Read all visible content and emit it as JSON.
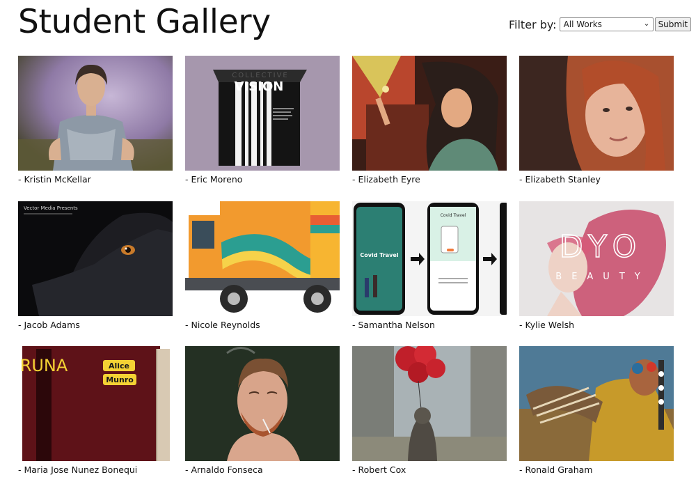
{
  "header": {
    "title": "Student Gallery"
  },
  "filter": {
    "label": "Filter by:",
    "selected": "All Works",
    "submit_label": "Submit"
  },
  "gallery": {
    "items": [
      {
        "caption": "- Kristin McKellar",
        "art": "painted woman in grey dress, purple background"
      },
      {
        "caption": "- Eric Moreno",
        "art": "black VISION box packaging, COLLECTIVE text"
      },
      {
        "caption": "- Elizabeth Eyre",
        "art": "illustrated man holding cigarette, warm tones"
      },
      {
        "caption": "- Elizabeth Stanley",
        "art": "portrait of red-haired woman"
      },
      {
        "caption": "- Jacob Adams",
        "art": "black dog close-up, Vector Media Presents"
      },
      {
        "caption": "- Nicole Reynolds",
        "art": "orange truck with striped livery"
      },
      {
        "caption": "- Samantha Nelson",
        "art": "Covid Travel app screens"
      },
      {
        "caption": "- Kylie Welsh",
        "art": "DYO BEAUTY, pink-haired woman"
      },
      {
        "caption": "- Maria Jose Nunez Bonequi",
        "art": "RUNA book cover, Alice Munro"
      },
      {
        "caption": "- Arnaldo Fonseca",
        "art": "bearded man smoking portrait"
      },
      {
        "caption": "- Robert Cox",
        "art": "red balloons in misty forest"
      },
      {
        "caption": "- Ronald Graham",
        "art": "native dancer with feathered regalia"
      }
    ]
  },
  "artwork_text": {
    "eric_top": "COLLECTIVE",
    "eric_main": "VISION",
    "jacob_line": "Vector Media Presents",
    "samantha_title": "Covid Travel",
    "samantha_screen2": "Covid Travel",
    "kylie_main": "DYO",
    "kylie_sub": "BEAUTY",
    "maria_title": "RUNA",
    "maria_author_1": "Alice",
    "maria_author_2": "Munro"
  }
}
